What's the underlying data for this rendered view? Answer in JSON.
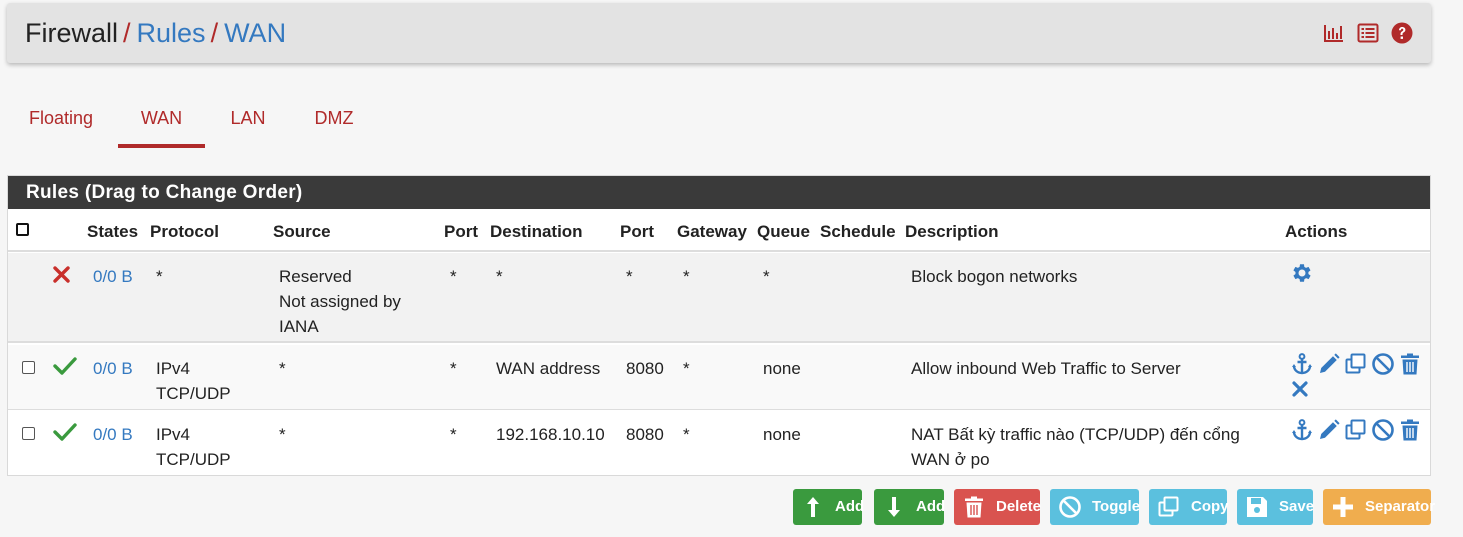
{
  "header": {
    "crumb_root": "Firewall",
    "crumb_rules": "Rules",
    "crumb_iface": "WAN",
    "separator": "/",
    "icons": [
      "chart-icon",
      "list-icon",
      "help-icon"
    ]
  },
  "tabs": [
    {
      "label": "Floating",
      "active": false
    },
    {
      "label": "WAN",
      "active": true
    },
    {
      "label": "LAN",
      "active": false
    },
    {
      "label": "DMZ",
      "active": false
    }
  ],
  "panel": {
    "title": "Rules (Drag to Change Order)",
    "columns": {
      "states": "States",
      "protocol": "Protocol",
      "source": "Source",
      "port": "Port",
      "destination": "Destination",
      "port2": "Port",
      "gateway": "Gateway",
      "queue": "Queue",
      "schedule": "Schedule",
      "description": "Description",
      "actions": "Actions"
    },
    "rows": [
      {
        "status": "block",
        "states": "0/0 B",
        "protocol": "*",
        "source_l1": "Reserved",
        "source_l2": "Not assigned by",
        "source_l3": "IANA",
        "port": "*",
        "destination": "*",
        "port2": "*",
        "gateway": "*",
        "queue": "*",
        "schedule": "",
        "description": "Block bogon networks"
      },
      {
        "status": "pass",
        "states": "0/0 B",
        "protocol_l1": "IPv4",
        "protocol_l2": "TCP/UDP",
        "source": "*",
        "port": "*",
        "destination": "WAN address",
        "port2": "8080",
        "gateway": "*",
        "queue": "none",
        "schedule": "",
        "description": "Allow inbound Web Traffic to Server"
      },
      {
        "status": "pass",
        "states": "0/0 B",
        "protocol_l1": "IPv4",
        "protocol_l2": "TCP/UDP",
        "source": "*",
        "port": "*",
        "destination": "192.168.10.10",
        "port2": "8080",
        "gateway": "*",
        "queue": "none",
        "schedule": "",
        "description_l1": "NAT Bất kỳ traffic nào (TCP/UDP) đến cổng",
        "description_l2": "WAN ở po"
      }
    ]
  },
  "buttons": {
    "add_top": "Add",
    "add_bottom": "Add",
    "delete": "Delete",
    "toggle": "Toggle",
    "copy": "Copy",
    "save": "Save",
    "separator": "Separator"
  },
  "colors": {
    "brand_red": "#b02a2a",
    "link_blue": "#3479c0",
    "success_green": "#3a9a3e",
    "danger_red": "#d9534f",
    "info_blue": "#5bc0de",
    "warning_orange": "#f0ad4e"
  }
}
